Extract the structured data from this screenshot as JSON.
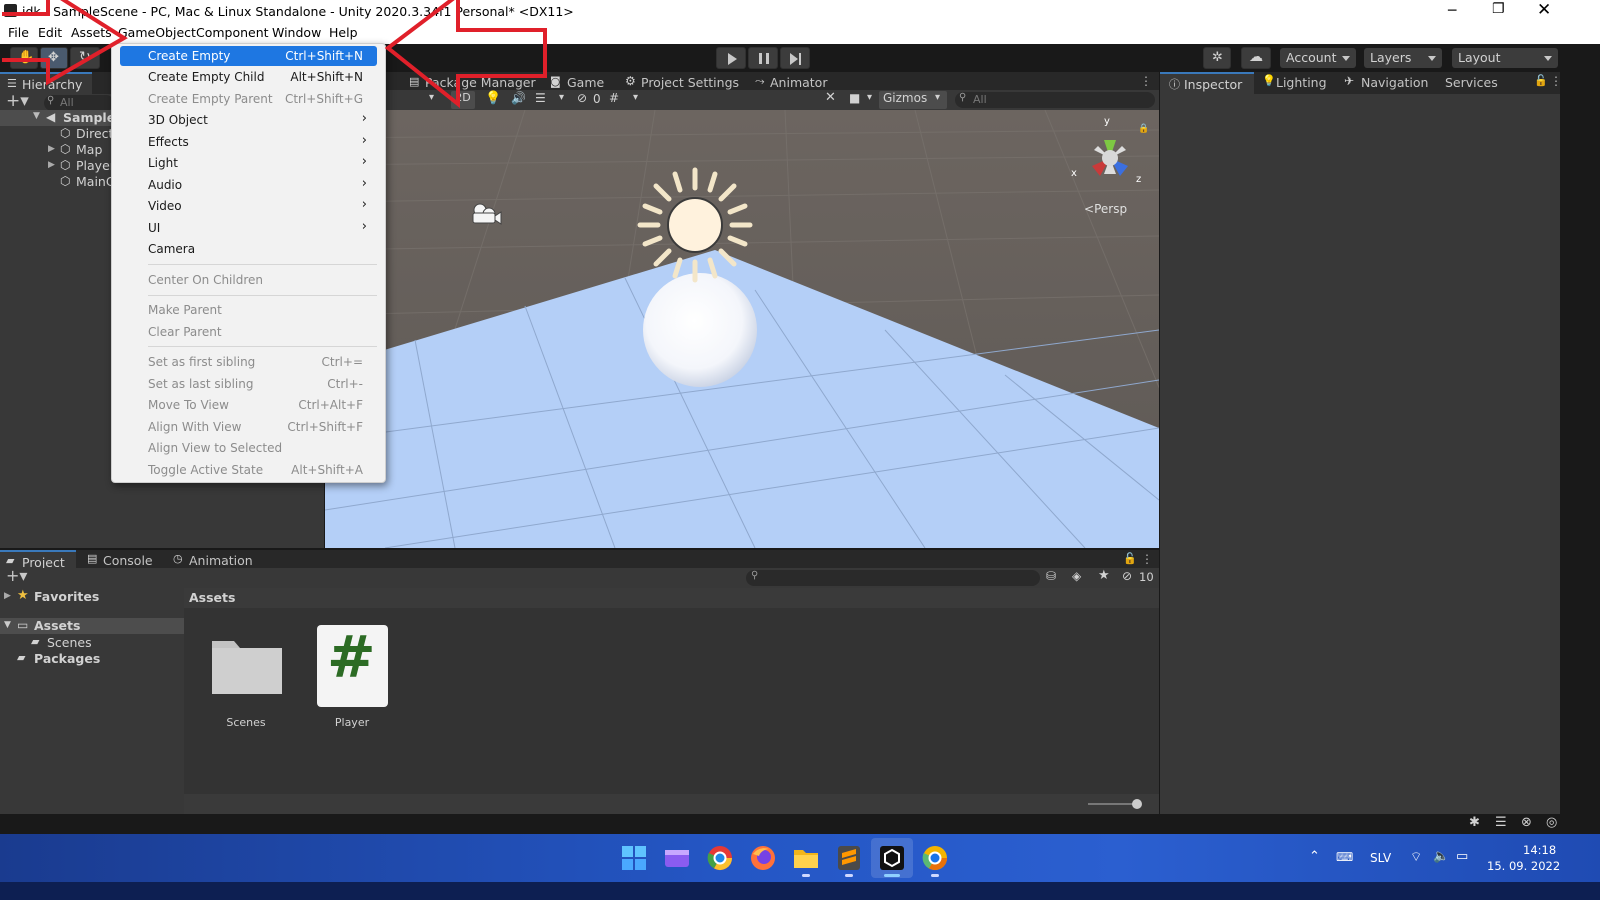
{
  "window": {
    "title": "idk - SampleScene - PC, Mac & Linux Standalone - Unity 2020.3.34f1 Personal* <DX11>",
    "controls": [
      "minimize",
      "restore",
      "close"
    ]
  },
  "menubar": {
    "items": [
      "File",
      "Edit",
      "Assets",
      "GameObject",
      "Component",
      "Window",
      "Help"
    ]
  },
  "toolbar": {
    "account": "Account",
    "layers": "Layers",
    "layout": "Layout"
  },
  "hierarchy": {
    "tab": "Hierarchy",
    "search_placeholder": "All",
    "scene": "SampleS",
    "items": [
      "Direct",
      "Map",
      "Player",
      "MainC"
    ]
  },
  "scene_view": {
    "tabs": [
      "Package Manager",
      "Game",
      "Project Settings",
      "Animator"
    ],
    "toolbar": {
      "mode_2d": "2D",
      "hidden_count": "0",
      "gizmos": "Gizmos",
      "search_placeholder": "All"
    },
    "gizmo": {
      "x": "x",
      "y": "y",
      "z": "z",
      "persp": "Persp"
    }
  },
  "right_tabs": [
    "Inspector",
    "Lighting",
    "Navigation",
    "Services"
  ],
  "project": {
    "tabs": [
      "Project",
      "Console",
      "Animation"
    ],
    "favorites": "Favorites",
    "tree": {
      "assets": "Assets",
      "scenes": "Scenes",
      "packages": "Packages"
    },
    "breadcrumb": "Assets",
    "hidden_count": "10",
    "assets": [
      {
        "name": "Scenes",
        "icon": "folder-icon"
      },
      {
        "name": "Player",
        "icon": "csharp-script-icon"
      }
    ]
  },
  "context_menu": {
    "items": [
      {
        "label": "Create Empty",
        "shortcut": "Ctrl+Shift+N",
        "state": "highlighted"
      },
      {
        "label": "Create Empty Child",
        "shortcut": "Alt+Shift+N",
        "state": "enabled"
      },
      {
        "label": "Create Empty Parent",
        "shortcut": "Ctrl+Shift+G",
        "state": "disabled"
      },
      {
        "label": "3D Object",
        "submenu": true,
        "state": "enabled"
      },
      {
        "label": "Effects",
        "submenu": true,
        "state": "enabled"
      },
      {
        "label": "Light",
        "submenu": true,
        "state": "enabled"
      },
      {
        "label": "Audio",
        "submenu": true,
        "state": "enabled"
      },
      {
        "label": "Video",
        "submenu": true,
        "state": "enabled"
      },
      {
        "label": "UI",
        "submenu": true,
        "state": "enabled"
      },
      {
        "label": "Camera",
        "state": "enabled"
      },
      {
        "label": "Center On Children",
        "state": "disabled"
      },
      {
        "label": "Make Parent",
        "state": "disabled"
      },
      {
        "label": "Clear Parent",
        "state": "disabled"
      },
      {
        "label": "Set as first sibling",
        "shortcut": "Ctrl+=",
        "state": "disabled"
      },
      {
        "label": "Set as last sibling",
        "shortcut": "Ctrl+-",
        "state": "disabled"
      },
      {
        "label": "Move To View",
        "shortcut": "Ctrl+Alt+F",
        "state": "disabled"
      },
      {
        "label": "Align With View",
        "shortcut": "Ctrl+Shift+F",
        "state": "disabled"
      },
      {
        "label": "Align View to Selected",
        "state": "disabled"
      },
      {
        "label": "Toggle Active State",
        "shortcut": "Alt+Shift+A",
        "state": "disabled"
      }
    ]
  },
  "taskbar": {
    "language": "SLV",
    "time": "14:18",
    "date": "15. 09. 2022",
    "apps": [
      "start-icon",
      "clipchamp-icon",
      "chrome-icon",
      "firefox-icon",
      "file-explorer-icon",
      "sublime-text-icon",
      "unity-icon",
      "chrome-canary-icon"
    ]
  },
  "colors": {
    "accent": "#1e77e2",
    "annotation": "#e0202a",
    "taskbar": "#2456c4",
    "floor": "#b4cff7"
  }
}
